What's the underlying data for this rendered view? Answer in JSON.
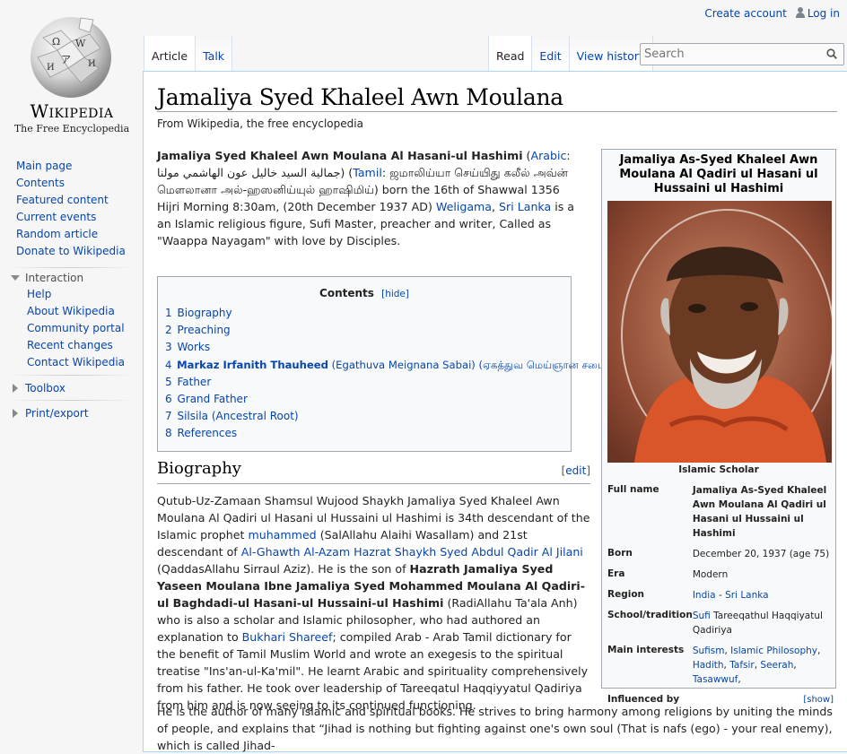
{
  "site": {
    "wordmark": "Wikipedia",
    "tagline": "The Free Encyclopedia"
  },
  "personal": {
    "create_account": "Create account",
    "login": "Log in"
  },
  "tabs": {
    "article": "Article",
    "talk": "Talk",
    "read": "Read",
    "edit": "Edit",
    "history": "View history"
  },
  "search": {
    "placeholder": "Search"
  },
  "sidebar": {
    "main": [
      "Main page",
      "Contents",
      "Featured content",
      "Current events",
      "Random article",
      "Donate to Wikipedia"
    ],
    "interaction_title": "Interaction",
    "interaction": [
      "Help",
      "About Wikipedia",
      "Community portal",
      "Recent changes",
      "Contact Wikipedia"
    ],
    "toolbox": "Toolbox",
    "printexport": "Print/export"
  },
  "page": {
    "title": "Jamaliya Syed Khaleel Awn Moulana",
    "subtitle": "From Wikipedia, the free encyclopedia",
    "intro": {
      "bold_name": "Jamaliya Syed Khaleel Awn Moulana Al Hasani-ul Hashimi",
      "p1": " (",
      "arabic_link": "Arabic",
      "arabic_text": ": جمالية السيد خاليل عون الهاشمي مولنا) (",
      "tamil_link": "Tamil",
      "tamil_text": ": ஜமாலிய்யா செய்யிது கலீல் அவ்ன் மௌலானா அல்-ஹஸனிய்யுல் ஹாஷிமிய்) born the 16th of Shawwal 1356 Hijri Morning 8:30am, (20th December 1937 AD) ",
      "weligama": "Weligama",
      "comma": ", ",
      "srilanka": "Sri Lanka",
      "rest": " is a an Islamic religious figure, Sufi Master, preacher and writer, Called as \"Waappa Nayagam\" with love by Disciples."
    },
    "toc": {
      "title": "Contents",
      "hide": "[hide]",
      "items": [
        {
          "num": "1",
          "pre": "",
          "bold": "",
          "text": "Biography"
        },
        {
          "num": "2",
          "pre": "",
          "bold": "",
          "text": "Preaching"
        },
        {
          "num": "3",
          "pre": "",
          "bold": "",
          "text": "Works"
        },
        {
          "num": "4",
          "pre": "",
          "bold": "Markaz Irfanith Thauheed",
          "text": " (Egathuva Meignana Sabai) (ஏகத்துவ மெய்ஞான சபை)"
        },
        {
          "num": "5",
          "pre": "",
          "bold": "",
          "text": "Father"
        },
        {
          "num": "6",
          "pre": "",
          "bold": "",
          "text": "Grand Father"
        },
        {
          "num": "7",
          "pre": "",
          "bold": "",
          "text": "Silsila (Ancestral Root)"
        },
        {
          "num": "8",
          "pre": "",
          "bold": "",
          "text": "References"
        }
      ]
    },
    "biography": {
      "heading": "Biography",
      "edit": "edit",
      "s1": "Qutub-Uz-Zamaan Shamsul Wujood Shaykh Jamaliya Syed Khaleel Awn Moulana Al Qadiri ul Hasani ul Hussaini ul Hashimi is 34th descendant of the Islamic prophet ",
      "muhammed": "muhammed",
      "s2": " (SalAllahu Alaihi Wasallam) and 21st descendant of ",
      "ghawth": "Al-Ghawth Al-Azam Hazrat Shaykh Syed Abdul Qadir Al Jilani",
      "s3": " (QaddasAllahu Sirraul Aziz). He is the son of ",
      "bold_father": "Hazrath Jamaliya Syed Yaseen Moulana Ibne Jamaliya Syed Mohammed Moulana Al Qadiri-ul Baghdadi-ul Hasani-ul Hussaini-ul Hashimi",
      "s4": " (RadiAllahu Ta'ala Anh) who is also a scholar and Islamic philosopher, who had authored an explanation to ",
      "bukhari": "Bukhari Shareef",
      "s5": "; compiled Arab - Arab Tamil dictionary for the benefit of Tamil Muslim World and wrote an exegesis to the spiritual treatise \"Ins'an-ul-Ka'mil\". He learnt Arabic and spirituality comprehensively from his father. He took over leadership of Tareeqatul Haqqiyyatul Qadiriya from him and is now seeing to its continued functioning.",
      "p2": "He is the author of many Islamic and spiritual books. He strives to bring harmony among religions by uniting the minds of people, and explains that “Jihad is nothing but fighting against one's own soul (That is nafs (ego) - your real enemy), which is called Jihad-"
    },
    "infobox": {
      "title": "Jamaliya As-Syed Khaleel Awn Moulana Al Qadiri ul Hasani ul Hussaini ul Hashimi",
      "caption": "Islamic Scholar",
      "full_name_label": "Full name",
      "full_name": "Jamaliya As-Syed Khaleel Awn Moulana Al Qadiri ul Hasani ul Hussaini ul Hashimi",
      "born_label": "Born",
      "born": "December 20, 1937 (age 75)",
      "era_label": "Era",
      "era": "Modern",
      "region_label": "Region",
      "region_india": "India",
      "region_sep": " - ",
      "region_srilanka": "Sri Lanka",
      "school_label": "School/tradition",
      "school_link": "Sufi",
      "school_rest": " Tareeqathul Haqqiyatul Qadiriya",
      "interests_label": "Main interests",
      "interests": [
        "Sufism",
        "Islamic Philosophy",
        "Hadith",
        "Tafsir",
        "Seerah",
        "Tasawwuf"
      ],
      "influenced_label": "Influenced by",
      "show": "[show]"
    }
  }
}
